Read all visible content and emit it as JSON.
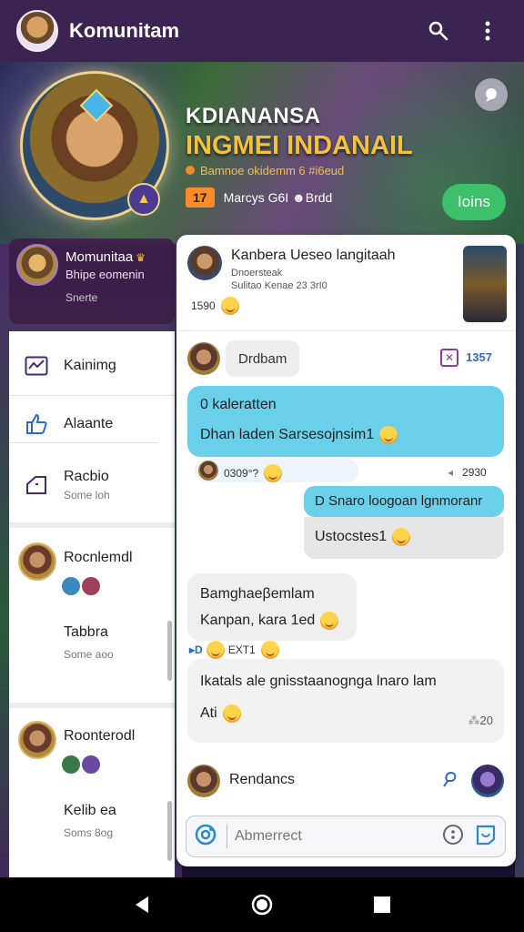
{
  "appbar": {
    "title": "Komunitam",
    "icons": [
      "search-icon",
      "more-icon"
    ]
  },
  "banner": {
    "title": "KDIANANSA",
    "subtitle": "INGMEI INDANAIL",
    "line": "Bamnoe okidemm 6 #i6eud",
    "count": "17",
    "count_label": "Marcys G6I ☻Brdd",
    "join_label": "Ioins"
  },
  "profile": {
    "name": "Momunitaa",
    "line": "Bhipe eomenin",
    "status": "Snerte"
  },
  "side_menu": [
    {
      "label": "Kainimg",
      "icon": "chart-icon"
    },
    {
      "label": "Alaante",
      "icon": "thumbs-up-icon"
    },
    {
      "label": "Racbio",
      "sub": "Some loh",
      "icon": "tag-icon"
    }
  ],
  "groups": [
    {
      "name": "Rocnlemdl",
      "sub": "Tabbra",
      "sub2": "Some aoo"
    },
    {
      "name": "Roonterodl",
      "sub": "Kelib ea",
      "sub2": "Soms 8og"
    }
  ],
  "pinned": {
    "title": "Kanbera Ueseo langitaah",
    "sub": "Dnoersteak",
    "sub2": "Sulitao Kenae 23 3rI0",
    "meta": "1590"
  },
  "messages": {
    "pill": "Drdbam",
    "tag_count": "1357",
    "blue_title": "0 kaleratten",
    "blue_text": "Dhan laden Sarsesojnsim1",
    "blue_meta_left": "0309°?",
    "blue_meta_right": "2930",
    "out_title": "D Snaro loogoan lgnmoranr",
    "out_text": "Ustocstes1",
    "in_title": "Bamghaeβemlam",
    "in_text": "Kanpan, kara 1ed",
    "in_meta": "EXT1",
    "long_text": "Ikatals ale gnisstaanognga lnaro lam",
    "long_meta": "Ati",
    "long_count": "20"
  },
  "reply": {
    "name": "Rendancs"
  },
  "input": {
    "placeholder": "Abmerrect"
  }
}
